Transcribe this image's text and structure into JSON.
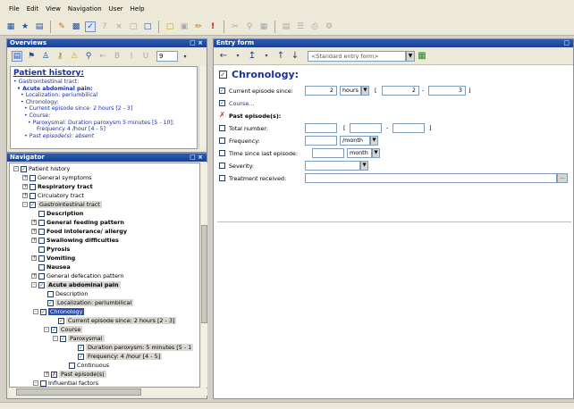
{
  "menu": [
    "File",
    "Edit",
    "View",
    "Navigation",
    "User",
    "Help"
  ],
  "toolbar_icons": [
    "save-icon",
    "open-icon",
    "chart-icon",
    "edit-icon",
    "doc-icon",
    "check-icon",
    "help-icon",
    "close-icon",
    "stop-icon",
    "new-icon",
    "copy-icon",
    "pencil-icon",
    "alert-icon",
    "cut-icon",
    "paste-icon",
    "find-icon",
    "form-icon",
    "table-icon",
    "list-icon",
    "print-icon",
    "settings-icon"
  ],
  "overviews": {
    "title": "Overviews",
    "controls": "□ ×",
    "page": "9",
    "patient_history": "Patient history:",
    "lines": [
      "• Gastrointestinal tract:",
      "• Acute abdominal pain:",
      "• Localization: periumbilical",
      "• Chronology:",
      "• Current episode since: 2 hours [2 - 3]",
      "• Course:",
      "• Paroxysmal: Duration paroxysm 5 minutes [5 - 10];",
      "Frequency 4 /hour [4 - 5]",
      "• Past episode(s): absent"
    ]
  },
  "navigator": {
    "title": "Navigator",
    "controls": "□ ×",
    "nodes": [
      {
        "label": "Patient history",
        "check": "v",
        "exp": "-"
      },
      {
        "label": "General symptoms",
        "check": "",
        "exp": "+"
      },
      {
        "label": "Respiratory tract",
        "check": "",
        "exp": "+"
      },
      {
        "label": "Circulatory tract",
        "check": "",
        "exp": "+"
      },
      {
        "label": "Gastrointestinal tract",
        "check": "v",
        "exp": "-"
      },
      {
        "label": "Description",
        "check": "",
        "exp": ""
      },
      {
        "label": "General feeding pattern",
        "check": "",
        "exp": "+"
      },
      {
        "label": "Food intolerance/ allergy",
        "check": "",
        "exp": "+"
      },
      {
        "label": "Swallowing difficulties",
        "check": "",
        "exp": "+"
      },
      {
        "label": "Pyrosis",
        "check": "",
        "exp": ""
      },
      {
        "label": "Vomiting",
        "check": "",
        "exp": "+"
      },
      {
        "label": "Nausea",
        "check": "",
        "exp": ""
      },
      {
        "label": "General defecation pattern",
        "check": "",
        "exp": "+"
      },
      {
        "label": "Acute abdominal pain",
        "check": "v",
        "exp": "-"
      },
      {
        "label": "Description",
        "check": "",
        "exp": ""
      },
      {
        "label": "Localization: periumbilical",
        "check": "v",
        "exp": ""
      },
      {
        "label": "Chronology",
        "check": "v",
        "exp": "-"
      },
      {
        "label": "Current episode since: 2 hours [2 - 3]",
        "check": "v",
        "exp": ""
      },
      {
        "label": "Course",
        "check": "v",
        "exp": "-"
      },
      {
        "label": "Paroxysmal",
        "check": "v",
        "exp": "-"
      },
      {
        "label": "Duration paroxysm: 5 minutes [5 - 1",
        "check": "v",
        "exp": ""
      },
      {
        "label": "Frequency: 4 /hour [4 - 5]",
        "check": "v",
        "exp": ""
      },
      {
        "label": "Continuous",
        "check": "",
        "exp": ""
      },
      {
        "label": "Past episode(s)",
        "check": "x",
        "exp": "+"
      },
      {
        "label": "Influential factors",
        "check": "",
        "exp": "-"
      }
    ]
  },
  "entry": {
    "title": "Entry form",
    "controls": "□",
    "form_select": "<Standard entry form>",
    "heading": "Chronology:",
    "current_episode_label": "Current episode since:",
    "current_value": "2",
    "current_unit": "hours",
    "bracket_open": "[",
    "range_low": "2",
    "range_dash": "-",
    "range_high": "3",
    "bracket_close": "]",
    "course_label": "Course...",
    "past_episodes_label": "Past episode(s):",
    "total_number_label": "Total number:",
    "frequency_label": "Frequency:",
    "frequency_unit": "/month",
    "time_since_label": "Time since last episode:",
    "time_since_unit": "month",
    "severity_label": "Severity:",
    "treatment_label": "Treatment received:",
    "ellipsis": "..."
  }
}
